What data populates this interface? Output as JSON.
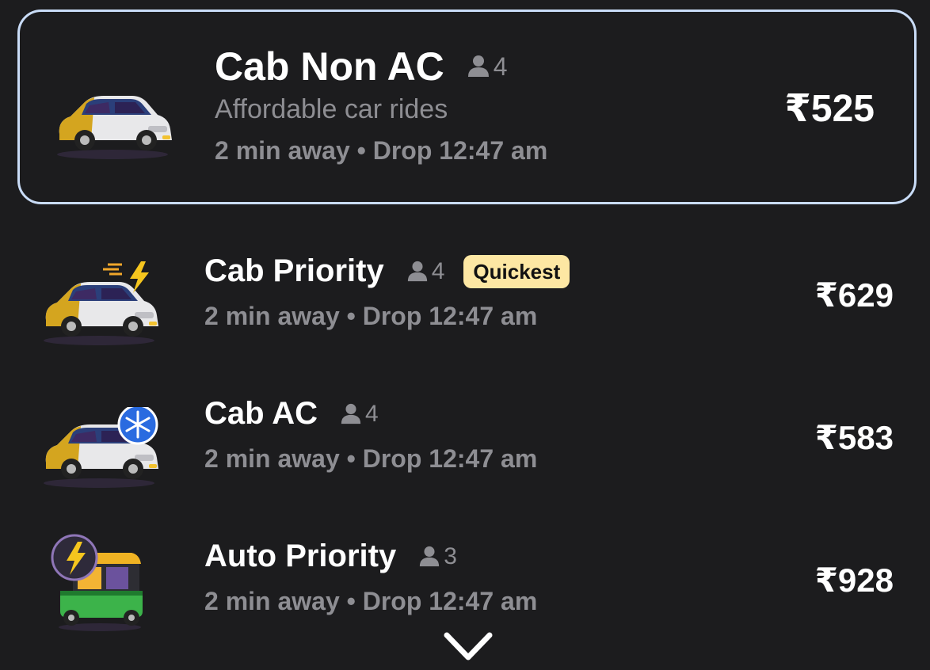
{
  "rides": [
    {
      "name": "Cab Non AC",
      "capacity": "4",
      "description": "Affordable car rides",
      "eta": "2 min away • Drop 12:47 am",
      "price": "₹525",
      "selected": true
    },
    {
      "name": "Cab Priority",
      "capacity": "4",
      "badge": "Quickest",
      "eta": "2 min away • Drop 12:47 am",
      "price": "₹629"
    },
    {
      "name": "Cab AC",
      "capacity": "4",
      "eta": "2 min away • Drop 12:47 am",
      "price": "₹583"
    },
    {
      "name": "Auto Priority",
      "capacity": "3",
      "eta": "2 min away • Drop 12:47 am",
      "price": "₹928"
    }
  ],
  "icons": {
    "capacity": "person-icon",
    "expand": "chevron-down-icon",
    "vehicles": [
      "taxi-car-icon",
      "taxi-car-priority-icon",
      "taxi-car-ac-icon",
      "auto-rickshaw-priority-icon"
    ]
  },
  "colors": {
    "background": "#1c1c1e",
    "selected_border": "#c9dcf7",
    "badge_bg": "#fde7a3",
    "muted_text": "#8e8e93",
    "text": "#ffffff"
  }
}
